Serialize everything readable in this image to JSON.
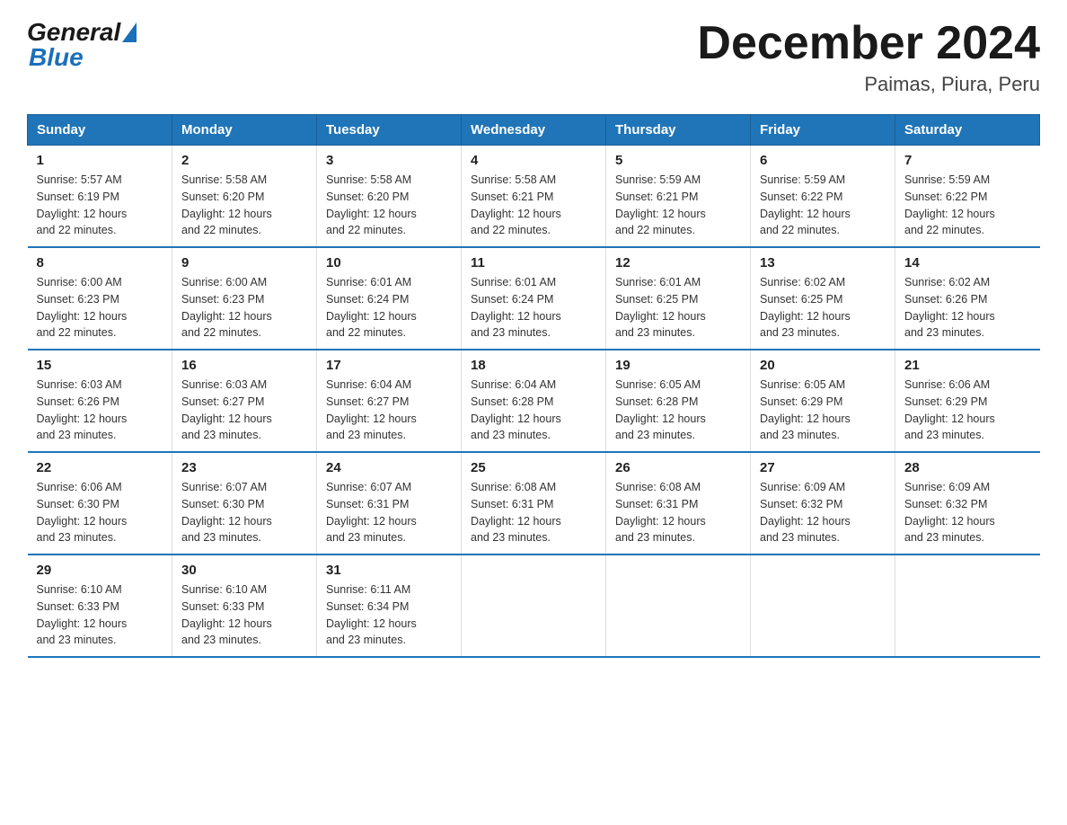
{
  "logo": {
    "text_general": "General",
    "triangle_color": "#1a6fba",
    "text_blue": "Blue"
  },
  "title": "December 2024",
  "subtitle": "Paimas, Piura, Peru",
  "days_of_week": [
    "Sunday",
    "Monday",
    "Tuesday",
    "Wednesday",
    "Thursday",
    "Friday",
    "Saturday"
  ],
  "weeks": [
    [
      {
        "day": "1",
        "sunrise": "5:57 AM",
        "sunset": "6:19 PM",
        "daylight": "12 hours and 22 minutes."
      },
      {
        "day": "2",
        "sunrise": "5:58 AM",
        "sunset": "6:20 PM",
        "daylight": "12 hours and 22 minutes."
      },
      {
        "day": "3",
        "sunrise": "5:58 AM",
        "sunset": "6:20 PM",
        "daylight": "12 hours and 22 minutes."
      },
      {
        "day": "4",
        "sunrise": "5:58 AM",
        "sunset": "6:21 PM",
        "daylight": "12 hours and 22 minutes."
      },
      {
        "day": "5",
        "sunrise": "5:59 AM",
        "sunset": "6:21 PM",
        "daylight": "12 hours and 22 minutes."
      },
      {
        "day": "6",
        "sunrise": "5:59 AM",
        "sunset": "6:22 PM",
        "daylight": "12 hours and 22 minutes."
      },
      {
        "day": "7",
        "sunrise": "5:59 AM",
        "sunset": "6:22 PM",
        "daylight": "12 hours and 22 minutes."
      }
    ],
    [
      {
        "day": "8",
        "sunrise": "6:00 AM",
        "sunset": "6:23 PM",
        "daylight": "12 hours and 22 minutes."
      },
      {
        "day": "9",
        "sunrise": "6:00 AM",
        "sunset": "6:23 PM",
        "daylight": "12 hours and 22 minutes."
      },
      {
        "day": "10",
        "sunrise": "6:01 AM",
        "sunset": "6:24 PM",
        "daylight": "12 hours and 22 minutes."
      },
      {
        "day": "11",
        "sunrise": "6:01 AM",
        "sunset": "6:24 PM",
        "daylight": "12 hours and 23 minutes."
      },
      {
        "day": "12",
        "sunrise": "6:01 AM",
        "sunset": "6:25 PM",
        "daylight": "12 hours and 23 minutes."
      },
      {
        "day": "13",
        "sunrise": "6:02 AM",
        "sunset": "6:25 PM",
        "daylight": "12 hours and 23 minutes."
      },
      {
        "day": "14",
        "sunrise": "6:02 AM",
        "sunset": "6:26 PM",
        "daylight": "12 hours and 23 minutes."
      }
    ],
    [
      {
        "day": "15",
        "sunrise": "6:03 AM",
        "sunset": "6:26 PM",
        "daylight": "12 hours and 23 minutes."
      },
      {
        "day": "16",
        "sunrise": "6:03 AM",
        "sunset": "6:27 PM",
        "daylight": "12 hours and 23 minutes."
      },
      {
        "day": "17",
        "sunrise": "6:04 AM",
        "sunset": "6:27 PM",
        "daylight": "12 hours and 23 minutes."
      },
      {
        "day": "18",
        "sunrise": "6:04 AM",
        "sunset": "6:28 PM",
        "daylight": "12 hours and 23 minutes."
      },
      {
        "day": "19",
        "sunrise": "6:05 AM",
        "sunset": "6:28 PM",
        "daylight": "12 hours and 23 minutes."
      },
      {
        "day": "20",
        "sunrise": "6:05 AM",
        "sunset": "6:29 PM",
        "daylight": "12 hours and 23 minutes."
      },
      {
        "day": "21",
        "sunrise": "6:06 AM",
        "sunset": "6:29 PM",
        "daylight": "12 hours and 23 minutes."
      }
    ],
    [
      {
        "day": "22",
        "sunrise": "6:06 AM",
        "sunset": "6:30 PM",
        "daylight": "12 hours and 23 minutes."
      },
      {
        "day": "23",
        "sunrise": "6:07 AM",
        "sunset": "6:30 PM",
        "daylight": "12 hours and 23 minutes."
      },
      {
        "day": "24",
        "sunrise": "6:07 AM",
        "sunset": "6:31 PM",
        "daylight": "12 hours and 23 minutes."
      },
      {
        "day": "25",
        "sunrise": "6:08 AM",
        "sunset": "6:31 PM",
        "daylight": "12 hours and 23 minutes."
      },
      {
        "day": "26",
        "sunrise": "6:08 AM",
        "sunset": "6:31 PM",
        "daylight": "12 hours and 23 minutes."
      },
      {
        "day": "27",
        "sunrise": "6:09 AM",
        "sunset": "6:32 PM",
        "daylight": "12 hours and 23 minutes."
      },
      {
        "day": "28",
        "sunrise": "6:09 AM",
        "sunset": "6:32 PM",
        "daylight": "12 hours and 23 minutes."
      }
    ],
    [
      {
        "day": "29",
        "sunrise": "6:10 AM",
        "sunset": "6:33 PM",
        "daylight": "12 hours and 23 minutes."
      },
      {
        "day": "30",
        "sunrise": "6:10 AM",
        "sunset": "6:33 PM",
        "daylight": "12 hours and 23 minutes."
      },
      {
        "day": "31",
        "sunrise": "6:11 AM",
        "sunset": "6:34 PM",
        "daylight": "12 hours and 23 minutes."
      },
      null,
      null,
      null,
      null
    ]
  ],
  "labels": {
    "sunrise": "Sunrise:",
    "sunset": "Sunset:",
    "daylight": "Daylight:"
  }
}
